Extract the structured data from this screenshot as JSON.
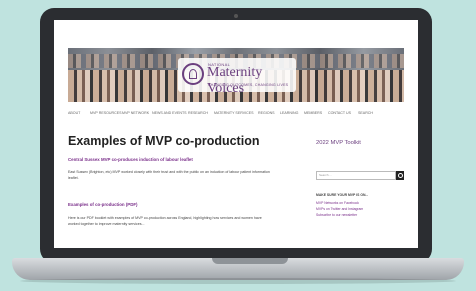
{
  "banner": {
    "logo_small": "NATIONAL",
    "logo_title": "Maternity Voices",
    "logo_sub": "CHANGING OUTCOMES, CHANGING LIVES"
  },
  "nav": {
    "items": [
      "ABOUT",
      "MVP RESOURCES",
      "MVP NETWORK",
      "NEWS AND EVENTS",
      "RESEARCH",
      "MATERNITY SERVICES",
      "REGIONS",
      "LEARNING",
      "MEMBERS",
      "CONTACT US",
      "SEARCH"
    ]
  },
  "main": {
    "title": "Examples of MVP co-production",
    "section1_heading": "Central Sussex MVP co-produces induction of labour leaflet",
    "section1_line1": "East Sussex (Brighton, etc) MVP worked closely with their trust and with the public on an induction of labour patient information",
    "section1_line2": "leaflet.",
    "section2_heading": "Examples of co-production (PDF)",
    "section2_line1": "Here is our PDF booklet with examples of MVP co-production across England, highlighting how services and women have",
    "section2_line2": "worked together to improve maternity services..."
  },
  "sidebar": {
    "title": "2022 MVP Toolkit",
    "search_placeholder": "Search ...",
    "list_heading": "MAKE SURE YOUR MVP IS ON...",
    "links": [
      "MVP Networks on Facebook",
      "MVPs on Twitter and Instagram",
      "Subscribe to our newsletter"
    ]
  },
  "colors": {
    "accent": "#7a2f8a",
    "background": "#bfe3df",
    "laptop_frame": "#2b2d31"
  }
}
